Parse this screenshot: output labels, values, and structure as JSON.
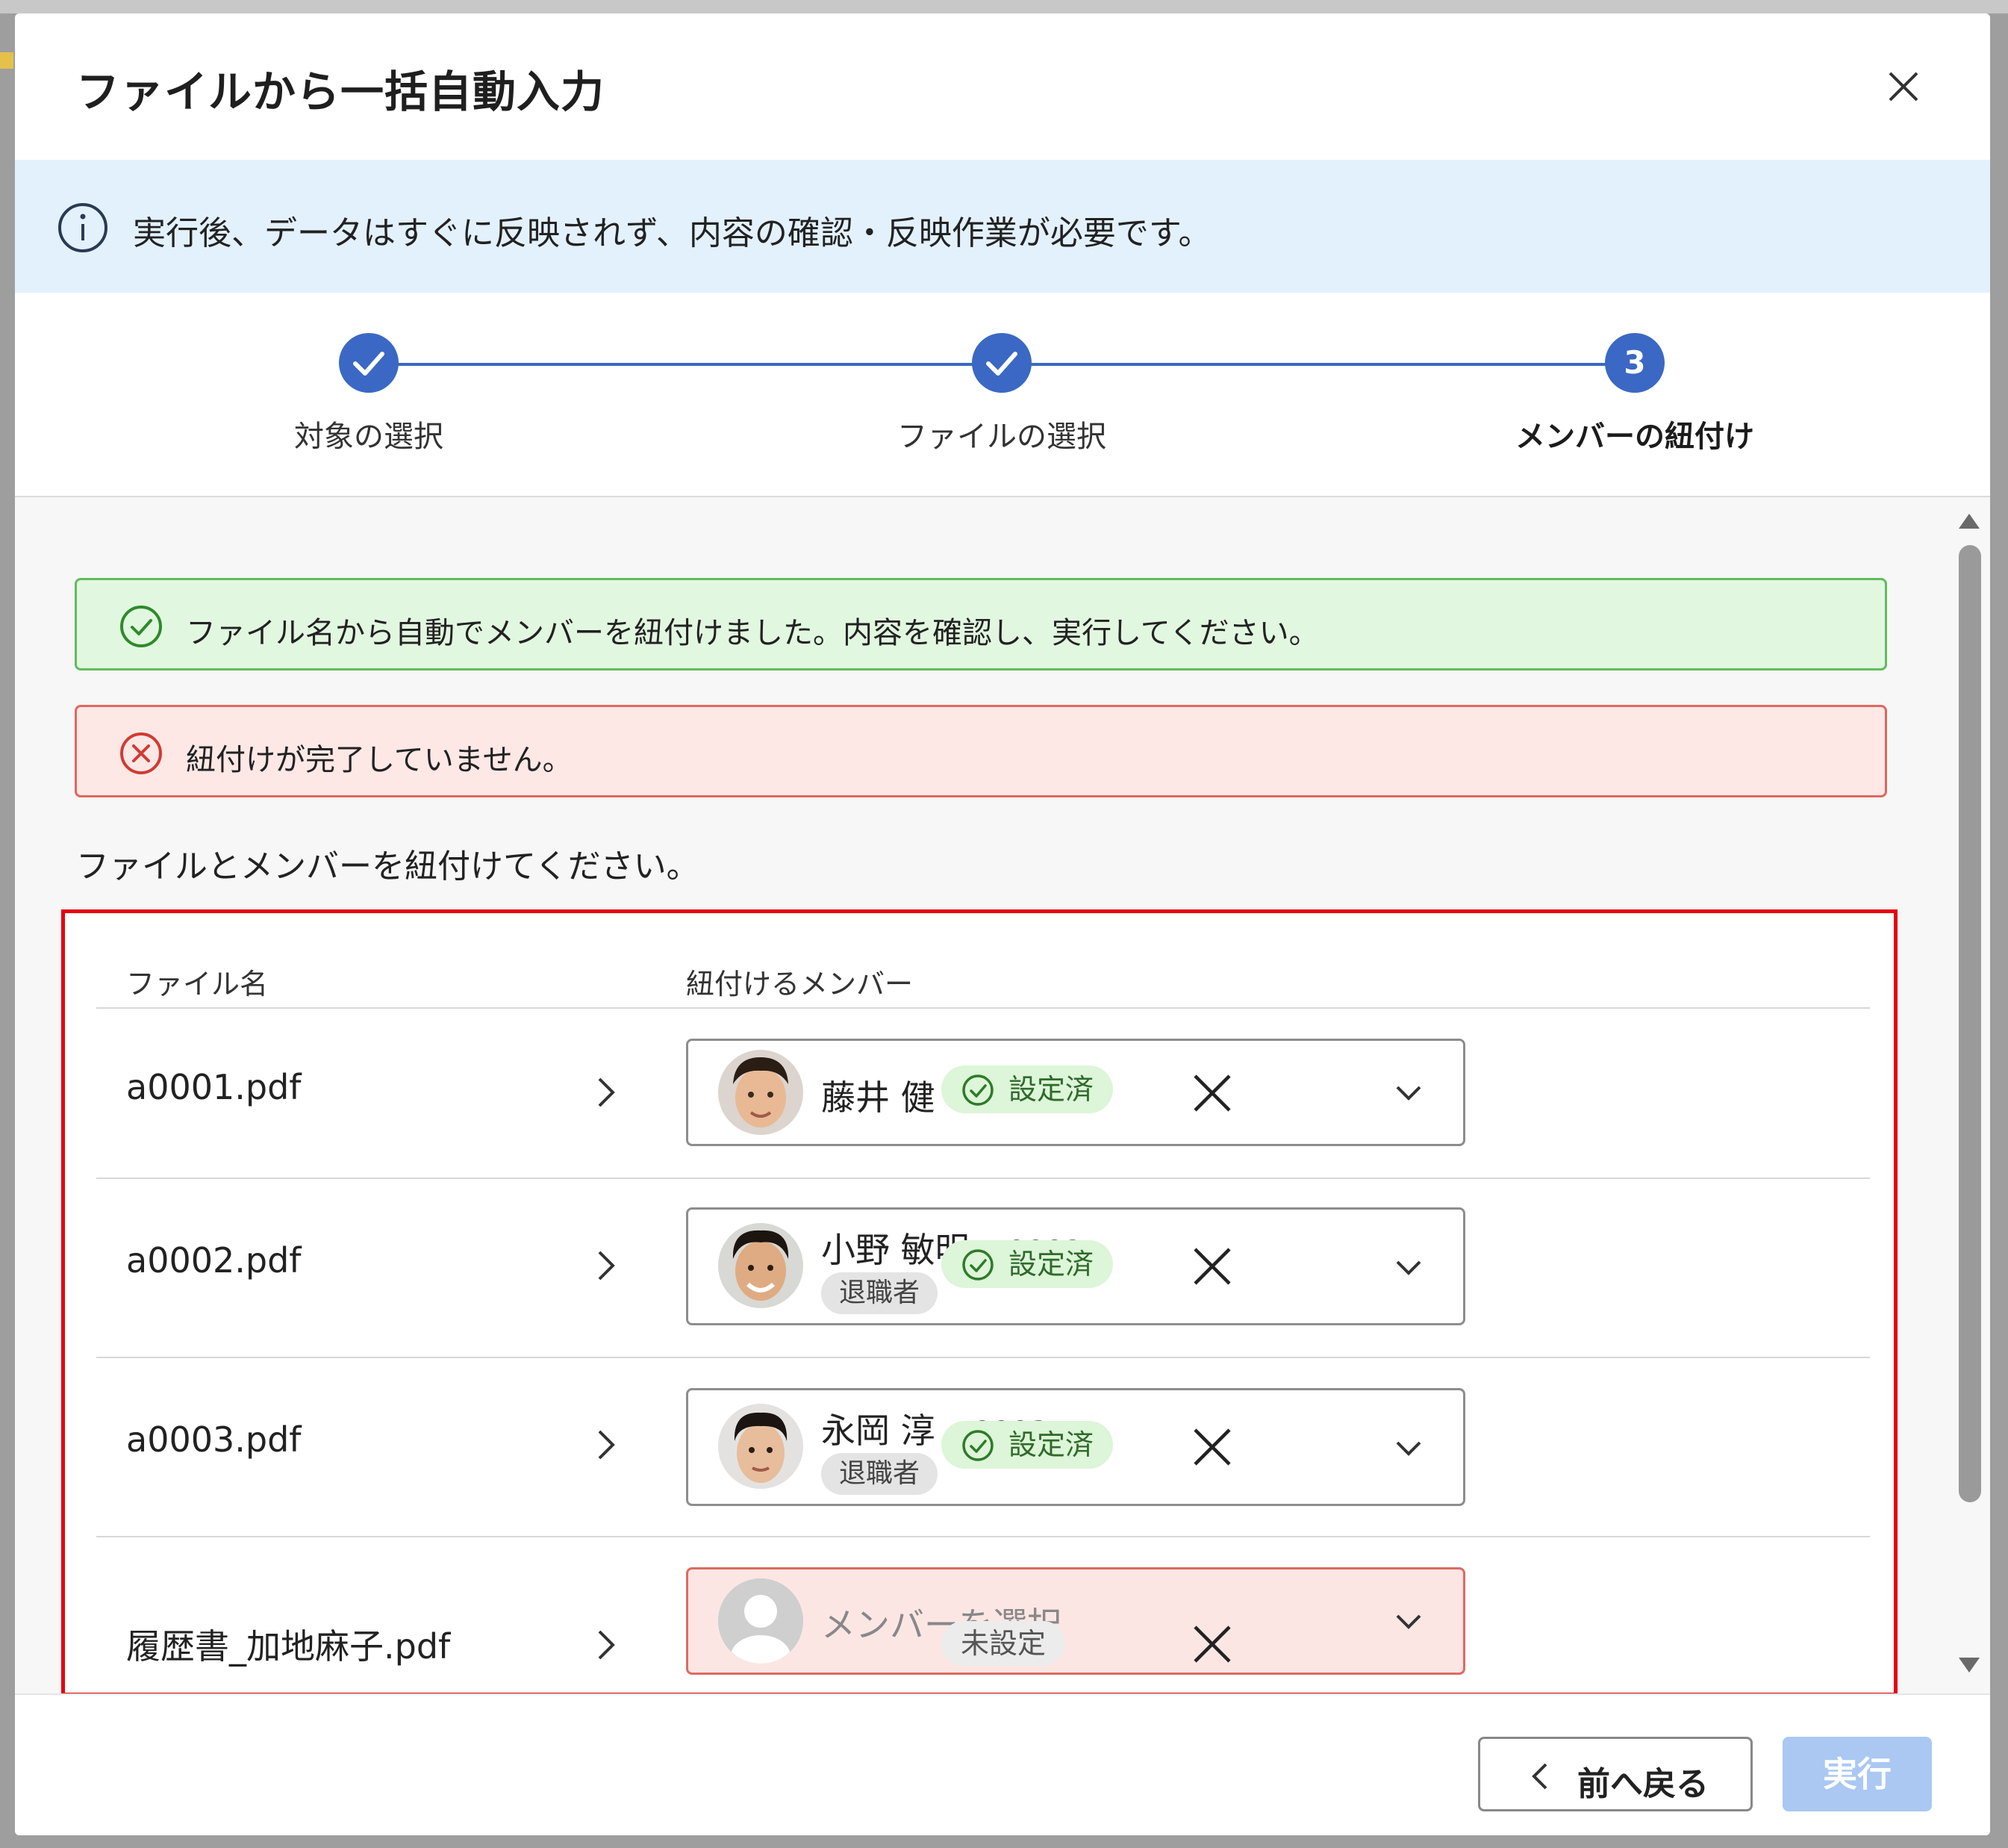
{
  "dialog": {
    "title": "ファイルから一括自動入力"
  },
  "info": {
    "text": "実行後、データはすぐに反映されず、内容の確認・反映作業が必要です。"
  },
  "stepper": {
    "steps": [
      {
        "label": "対象の選択",
        "state": "done"
      },
      {
        "label": "ファイルの選択",
        "state": "done"
      },
      {
        "label": "メンバーの紐付け",
        "number": "3",
        "state": "active"
      }
    ]
  },
  "alerts": {
    "success": "ファイル名から自動でメンバーを紐付けました。内容を確認し、実行してください。",
    "error": "紐付けが完了していません。"
  },
  "instruction": "ファイルとメンバーを紐付けてください。",
  "table": {
    "headers": {
      "file": "ファイル名",
      "member": "紐付けるメンバー"
    },
    "rows": [
      {
        "file": "a0001.pdf",
        "member_name": "藤井 健",
        "member_code": "a0001",
        "retired": "",
        "status": "設定済"
      },
      {
        "file": "a0002.pdf",
        "member_name": "小野 敏明",
        "member_code": "a0002",
        "retired": "退職者",
        "status": "設定済"
      },
      {
        "file": "a0003.pdf",
        "member_name": "永岡 淳",
        "member_code": "a0003",
        "retired": "退職者",
        "status": "設定済"
      },
      {
        "file": "履歴書_加地麻子.pdf",
        "placeholder": "メンバーを選択",
        "status": "未設定"
      }
    ]
  },
  "footer": {
    "back": "前へ戻る",
    "execute": "実行"
  },
  "colors": {
    "primary": "#3a68c4",
    "success_bg": "#e2f7e0",
    "error_bg": "#fde8e6",
    "highlight": "#e5000f",
    "execute_disabled": "#aac8f2"
  }
}
